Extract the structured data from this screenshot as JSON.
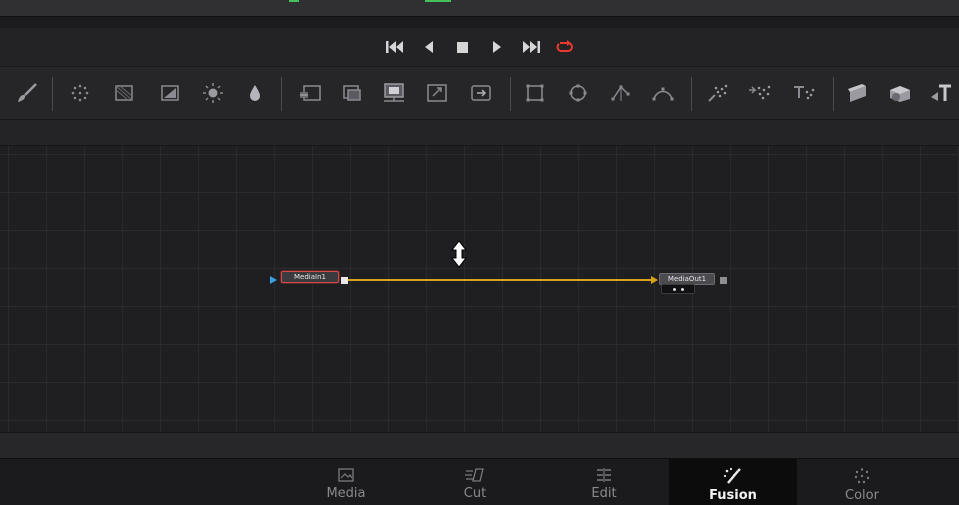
{
  "colors": {
    "accent_green": "#44c15a",
    "loop_red": "#e83a2e",
    "link_yellow": "#d8a31c",
    "node_in_border": "#d34848",
    "input_arrow_blue": "#3aa0e6"
  },
  "transport": {
    "buttons": [
      {
        "name": "go-to-start",
        "icon": "skip-back-icon"
      },
      {
        "name": "play-reverse",
        "icon": "play-reverse-icon"
      },
      {
        "name": "stop",
        "icon": "stop-icon"
      },
      {
        "name": "play-forward",
        "icon": "play-icon"
      },
      {
        "name": "go-to-end",
        "icon": "skip-forward-icon"
      },
      {
        "name": "loop",
        "icon": "loop-icon"
      }
    ]
  },
  "toolbar": {
    "tools": [
      "paint-brush-icon",
      "particles-icon",
      "background-icon",
      "gradient-icon",
      "brightness-icon",
      "blur-drop-icon",
      "merge-icon",
      "layer-icon",
      "media-in-icon",
      "transform-icon",
      "crop-icon",
      "rectangle-mask-icon",
      "ellipse-mask-icon",
      "polygon-mask-icon",
      "bspline-mask-icon",
      "particle-emitter-icon",
      "particle-render-icon",
      "text-particle-icon",
      "shape3d-icon",
      "merge3d-icon",
      "text3d-icon"
    ]
  },
  "nodes": {
    "media_in": {
      "label": "MediaIn1"
    },
    "media_out": {
      "label": "MediaOut1"
    }
  },
  "cursor": {
    "icon": "move-vertical-cursor-icon"
  },
  "pages": {
    "items": [
      {
        "label": "Media",
        "icon": "media-page-icon",
        "active": false
      },
      {
        "label": "Cut",
        "icon": "cut-page-icon",
        "active": false
      },
      {
        "label": "Edit",
        "icon": "edit-page-icon",
        "active": false
      },
      {
        "label": "Fusion",
        "icon": "fusion-page-icon",
        "active": true
      },
      {
        "label": "Color",
        "icon": "color-page-icon",
        "active": false
      }
    ]
  }
}
